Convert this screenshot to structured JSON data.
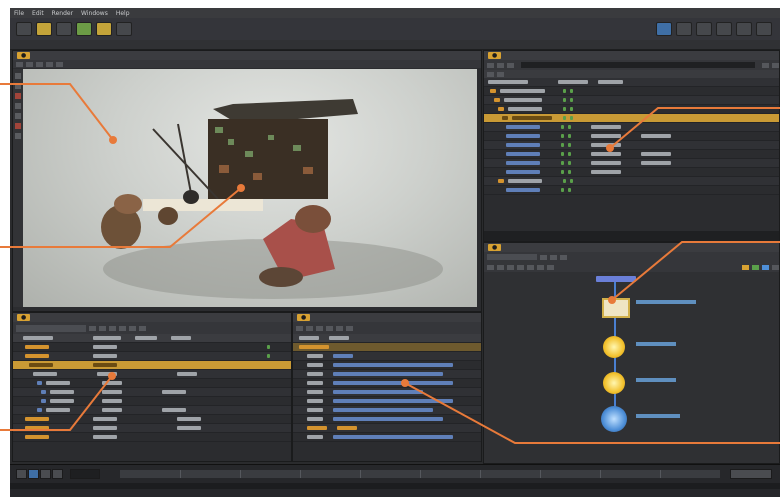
{
  "window": {
    "menu": [
      "File",
      "Edit",
      "Render",
      "Windows",
      "Help"
    ],
    "accent_color": "#d8a232",
    "callout_color": "#e87a3a"
  },
  "viewport": {
    "tab_label": "",
    "icon": "camera-icon"
  },
  "scene_graph": {
    "tab_label": ""
  },
  "outliner": {
    "tab_label": ""
  },
  "parameters": {
    "tab_label": ""
  },
  "node_graph": {
    "tab_label": "",
    "nodes": [
      {
        "icon": "render-node-icon",
        "color": "#e8d35a"
      },
      {
        "icon": "material-node-icon",
        "color": "#e9e2c6"
      },
      {
        "icon": "light-bulb-icon",
        "color": "#f2c12e"
      },
      {
        "icon": "light-bulb-icon",
        "color": "#f2c12e"
      },
      {
        "icon": "merge-node-icon",
        "color": "#4e8fd8"
      }
    ]
  },
  "timeline": {
    "controls": [
      "play-icon",
      "stop-icon",
      "step-icon"
    ]
  }
}
